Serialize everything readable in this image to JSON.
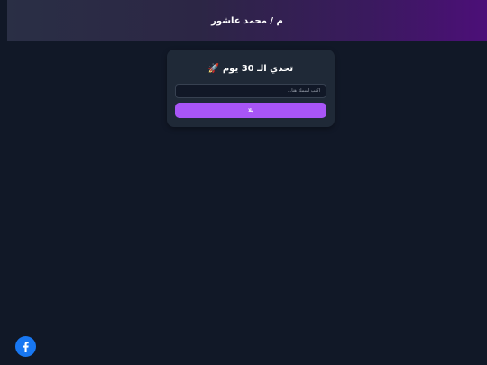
{
  "header": {
    "title": "م / محمد عاشور"
  },
  "card": {
    "title": "تحدي الـ 30 يوم",
    "title_icon": "rocket-icon",
    "name_input": {
      "value": "",
      "placeholder": "اكتب اسمك هنا..."
    },
    "start_label": "يلا"
  },
  "social": {
    "facebook_icon": "facebook-icon"
  },
  "colors": {
    "background": "#111827",
    "card": "#1f2937",
    "accent": "#a855f7",
    "header_gradient_end": "#4c0f78",
    "facebook": "#1877f2"
  }
}
